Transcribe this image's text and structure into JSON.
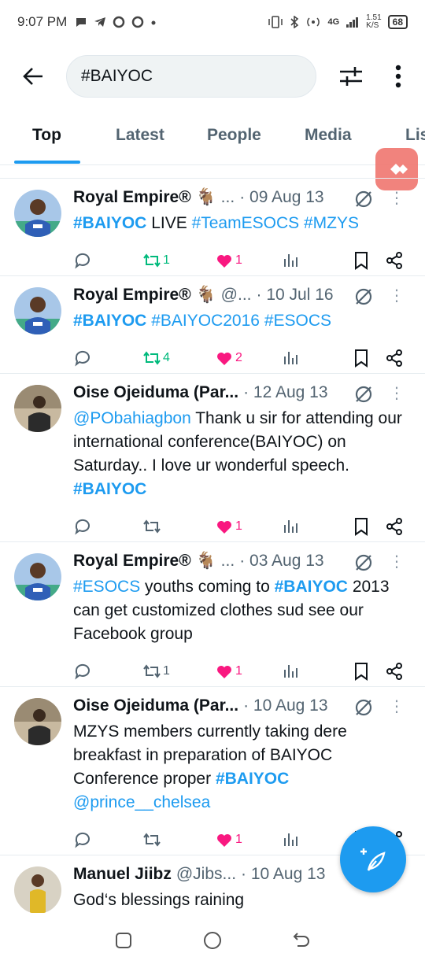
{
  "status_bar": {
    "time": "9:07 PM",
    "network": "4G",
    "speed_value": "1.51",
    "speed_unit": "K/S",
    "battery": "68"
  },
  "search": {
    "query": "#BAIYOC"
  },
  "tabs": [
    {
      "label": "Top",
      "active": true
    },
    {
      "label": "Latest",
      "active": false
    },
    {
      "label": "People",
      "active": false
    },
    {
      "label": "Media",
      "active": false
    },
    {
      "label": "Lis",
      "active": false
    }
  ],
  "tweets": [
    {
      "name": "Royal Empire® 🐐",
      "handle": "...",
      "date": "· 09 Aug 13",
      "avatar": "royal",
      "segments": [
        {
          "text": "#BAIYOC",
          "type": "tag"
        },
        {
          "text": " LIVE ",
          "type": "text"
        },
        {
          "text": "#TeamESOCS",
          "type": "mention"
        },
        {
          "text": " ",
          "type": "text"
        },
        {
          "text": "#MZYS",
          "type": "mention"
        }
      ],
      "retweets": "1",
      "retweeted": true,
      "likes": "1"
    },
    {
      "name": "Royal Empire® 🐐",
      "handle": "@...",
      "date": "· 10 Jul 16",
      "avatar": "royal",
      "segments": [
        {
          "text": "#BAIYOC",
          "type": "tag"
        },
        {
          "text": " ",
          "type": "text"
        },
        {
          "text": "#BAIYOC2016",
          "type": "mention"
        },
        {
          "text": " ",
          "type": "text"
        },
        {
          "text": "#ESOCS",
          "type": "mention"
        }
      ],
      "retweets": "4",
      "retweeted": true,
      "likes": "2"
    },
    {
      "name": "Oise Ojeiduma (Par...",
      "handle": "",
      "date": "· 12 Aug 13",
      "avatar": "oise",
      "segments": [
        {
          "text": "@PObahiagbon",
          "type": "mention"
        },
        {
          "text": " Thank u sir for attending our international conference(BAIYOC) on Saturday.. I  love ur wonderful speech. ",
          "type": "text"
        },
        {
          "text": "#BAIYOC",
          "type": "tag"
        }
      ],
      "retweets": "",
      "retweeted": false,
      "likes": "1"
    },
    {
      "name": "Royal Empire® 🐐",
      "handle": "...",
      "date": "· 03 Aug 13",
      "avatar": "royal",
      "segments": [
        {
          "text": "#ESOCS",
          "type": "mention"
        },
        {
          "text": " youths coming to ",
          "type": "text"
        },
        {
          "text": "#BAIYOC",
          "type": "tag"
        },
        {
          "text": " 2013 can get customized clothes sud see our Facebook group",
          "type": "text"
        }
      ],
      "retweets": "1",
      "retweeted": false,
      "likes": "1"
    },
    {
      "name": "Oise Ojeiduma (Par...",
      "handle": "",
      "date": "· 10 Aug 13",
      "avatar": "oise",
      "segments": [
        {
          "text": "MZYS members currently taking dere breakfast in preparation of BAIYOC Conference proper ",
          "type": "text"
        },
        {
          "text": "#BAIYOC",
          "type": "tag"
        },
        {
          "text": " ",
          "type": "text"
        },
        {
          "text": "@prince__chelsea",
          "type": "mention"
        }
      ],
      "retweets": "",
      "retweeted": false,
      "likes": "1"
    },
    {
      "name": "Manuel Jiibz",
      "handle": "@Jibs...",
      "date": "· 10 Aug 13",
      "avatar": "manuel",
      "segments": [
        {
          "text": "God‘s blessings raining",
          "type": "text"
        }
      ],
      "retweets": "",
      "retweeted": false,
      "likes": ""
    }
  ],
  "colors": {
    "accent": "#1d9bf0",
    "retweet": "#00ba7c",
    "like": "#f91880",
    "muted": "#536471"
  }
}
